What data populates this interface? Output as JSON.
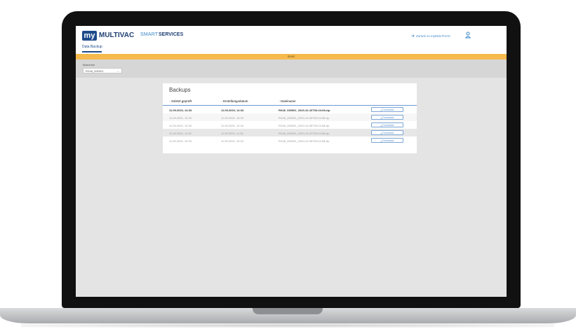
{
  "app": {
    "logo_my": "my",
    "logo_brand": "MULTIVAC",
    "logo_smart": "SMART",
    "logo_services": "SERVICES",
    "back_link": "Zurück zu myMULTIVAC",
    "tab_active": "Data Backup"
  },
  "banner": {
    "text": "DEMO"
  },
  "machine": {
    "label": "Maschine",
    "selected": "RX46_000001"
  },
  "backups": {
    "title": "Backups",
    "columns": [
      "Zuletzt geprüft",
      "Erstellungsdatum",
      "Dateiname"
    ],
    "rows": [
      {
        "checked": "11.09.2020, 14:33",
        "created": "11.09.2020, 14:33",
        "filename": "RX46_000001_2020-10-10T03:24:08.zip",
        "action": "Download"
      },
      {
        "checked": "11.09.2020, 13:33",
        "created": "11.09.2020, 13:33",
        "filename": "RX46_000001_2020-10-09T03:24:08.zip",
        "action": "Download"
      },
      {
        "checked": "11.09.2020, 12:33",
        "created": "11.09.2020, 12:33",
        "filename": "RX46_000001_2020-10-08T03:24:08.zip",
        "action": "Download"
      },
      {
        "checked": "11.09.2020, 11:33",
        "created": "11.09.2020, 11:33",
        "filename": "RX46_000001_2020-10-07T03:24:08.zip",
        "action": "Download"
      },
      {
        "checked": "11.09.2020, 10:33",
        "created": "11.09.2020, 10:33",
        "filename": "RX46_000001_2020-10-06T03:24:08.zip",
        "action": "Download"
      }
    ]
  },
  "colors": {
    "brand_blue": "#1e4a8a",
    "accent_blue": "#3d88c9",
    "banner": "#f5b94c"
  }
}
